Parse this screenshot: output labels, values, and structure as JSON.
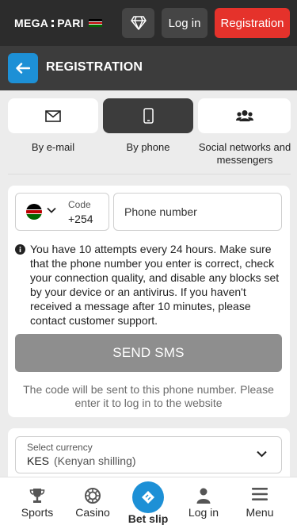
{
  "header": {
    "logo_left": "MEGA",
    "logo_right": "PARI",
    "login_label": "Log in",
    "register_label": "Registration"
  },
  "section": {
    "title": "REGISTRATION"
  },
  "methods": [
    {
      "label": "By e-mail",
      "icon": "envelope-icon",
      "active": false
    },
    {
      "label": "By phone",
      "icon": "phone-icon",
      "active": true
    },
    {
      "label": "Social networks and messengers",
      "icon": "users-icon",
      "active": false
    }
  ],
  "phone_form": {
    "code_label": "Code",
    "code_value": "+254",
    "phone_placeholder": "Phone number",
    "info": "You have 10 attempts every 24 hours. Make sure that the phone number you enter is correct, check your connection quality, and disable any blocks set by your device or an antivirus. If you haven't received a message after 10 minutes, please contact customer support.",
    "send_label": "SEND SMS",
    "hint": "The code will be sent to this phone number. Please enter it to log in to the website"
  },
  "currency": {
    "label": "Select currency",
    "code": "KES",
    "name": "(Kenyan shilling)"
  },
  "nav": {
    "sports": "Sports",
    "casino": "Casino",
    "betslip": "Bet slip",
    "login": "Log in",
    "menu": "Menu"
  },
  "colors": {
    "accent_blue": "#1d90d6",
    "register_red": "#e5322b",
    "header_dark": "#2c2c2c",
    "kenya_black": "#000000",
    "kenya_red": "#bb0000",
    "kenya_green": "#006600"
  }
}
